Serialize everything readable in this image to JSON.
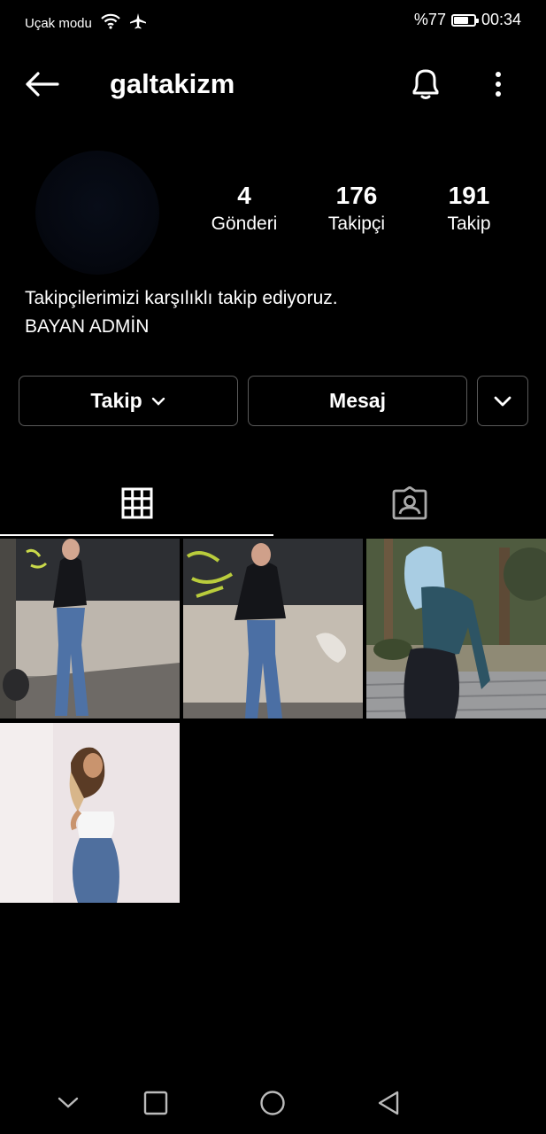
{
  "status_bar": {
    "carrier": "Uçak modu",
    "battery": "%77",
    "battery_level": 0.77,
    "time": "00:34"
  },
  "header": {
    "username": "galtakizm"
  },
  "stats": [
    {
      "value": "4",
      "label": "Gönderi"
    },
    {
      "value": "176",
      "label": "Takipçi"
    },
    {
      "value": "191",
      "label": "Takip"
    }
  ],
  "bio": {
    "line1": "Takipçilerimizi karşılıklı takip ediyoruz.",
    "line2": "BAYAN ADMİN"
  },
  "buttons": {
    "follow": "Takip",
    "message": "Mesaj"
  },
  "tabs": [
    {
      "icon": "grid-icon"
    },
    {
      "icon": "tagged-icon"
    }
  ],
  "posts": [
    {
      "desc": "woman in black jacket and jeans near graffiti wall"
    },
    {
      "desc": "woman leaning on graffiti wall"
    },
    {
      "desc": "woman with blue hair in teal sweater on cobblestone street"
    },
    {
      "desc": "woman in white top and jeans against pink wall"
    }
  ],
  "colors": {
    "background": "#000000",
    "border": "#5a5a5a",
    "text": "#ffffff"
  }
}
